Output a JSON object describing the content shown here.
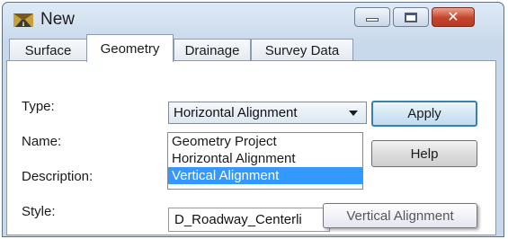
{
  "window": {
    "title": "New",
    "icon": "road-app-icon"
  },
  "tabs": [
    {
      "label": "Surface",
      "active": false
    },
    {
      "label": "Geometry",
      "active": true
    },
    {
      "label": "Drainage",
      "active": false
    },
    {
      "label": "Survey Data",
      "active": false
    }
  ],
  "form": {
    "type_label": "Type:",
    "type_value": "Horizontal Alignment",
    "name_label": "Name:",
    "description_label": "Description:",
    "style_label": "Style:",
    "style_value": "D_Roadway_Centerli"
  },
  "dropdown": {
    "options": [
      "Geometry Project",
      "Horizontal Alignment",
      "Vertical Alignment"
    ],
    "highlighted": "Vertical Alignment"
  },
  "buttons": {
    "apply": "Apply",
    "help": "Help"
  },
  "tooltip": "Vertical Alignment"
}
